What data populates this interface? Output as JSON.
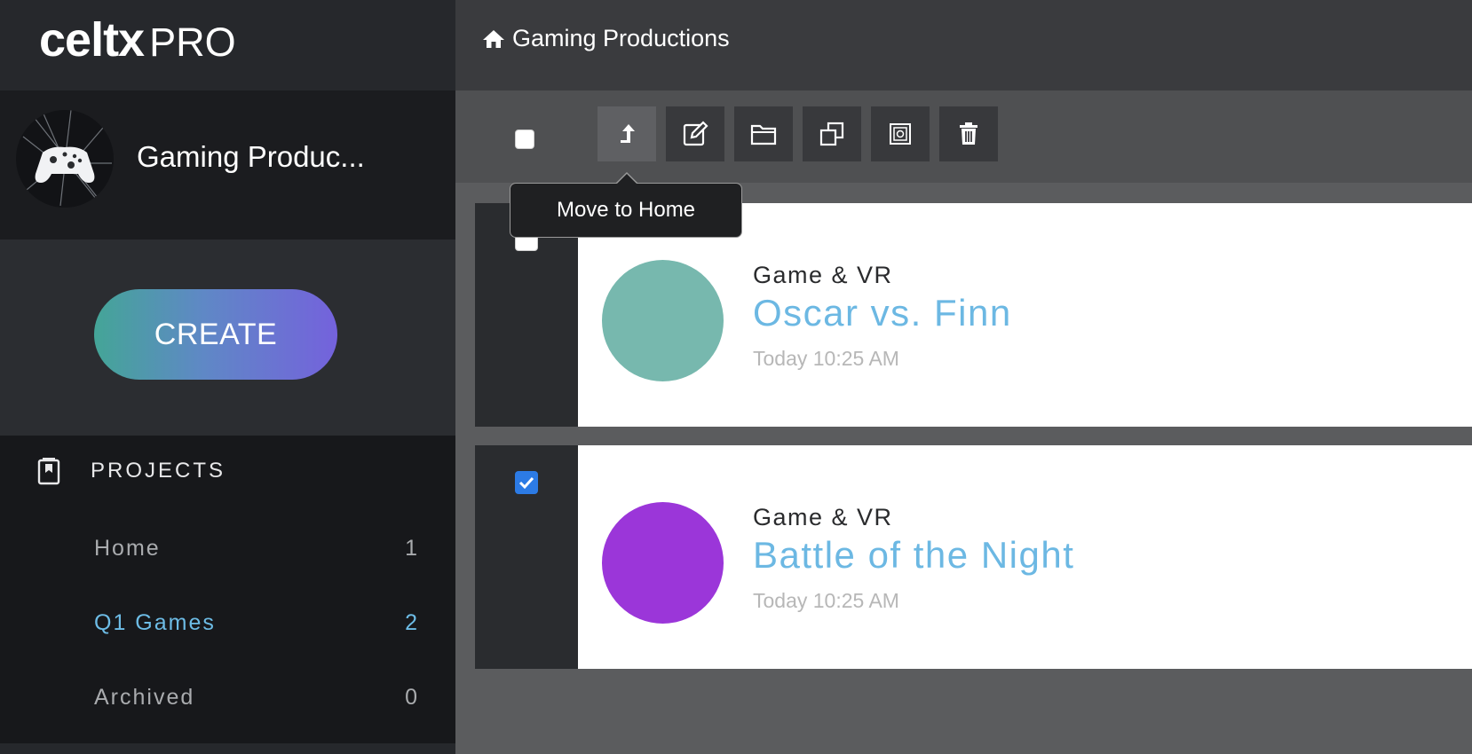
{
  "app": {
    "logo_main": "celtx",
    "logo_sub": "PRO"
  },
  "workspace": {
    "name": "Gaming Produc..."
  },
  "sidebar": {
    "create_label": "CREATE",
    "projects_title": "PROJECTS",
    "items": [
      {
        "label": "Home",
        "count": "1",
        "active": false
      },
      {
        "label": "Q1 Games",
        "count": "2",
        "active": true
      },
      {
        "label": "Archived",
        "count": "0",
        "active": false
      }
    ]
  },
  "header": {
    "breadcrumb": "Gaming Productions"
  },
  "toolbar": {
    "actions": [
      "move-to-home",
      "edit",
      "folder",
      "duplicate",
      "archive",
      "delete"
    ],
    "tooltip": "Move to Home"
  },
  "projects": [
    {
      "category": "Game & VR",
      "title": "Oscar vs. Finn",
      "time": "Today 10:25 AM",
      "color": "#77b8ae",
      "checked": false
    },
    {
      "category": "Game & VR",
      "title": "Battle of the Night",
      "time": "Today 10:25 AM",
      "color": "#9b36d9",
      "checked": true
    }
  ],
  "colors": {
    "accent": "#6dbce6",
    "checkbox": "#2c7be5"
  }
}
